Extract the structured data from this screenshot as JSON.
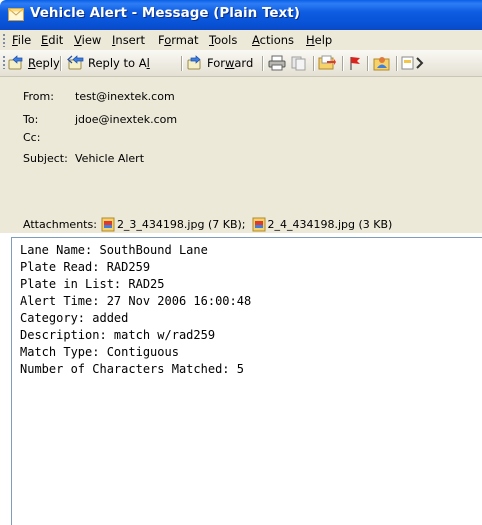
{
  "window": {
    "title": "Vehicle Alert - Message (Plain Text)"
  },
  "menu": [
    {
      "label": "File",
      "mnemonic": "F",
      "rest": "ile"
    },
    {
      "label": "Edit",
      "mnemonic": "E",
      "rest": "dit"
    },
    {
      "label": "View",
      "mnemonic": "V",
      "rest": "iew"
    },
    {
      "label": "Insert",
      "mnemonic": "I",
      "rest": "nsert"
    },
    {
      "label": "Format",
      "pre": "F",
      "mnemonic": "o",
      "rest": "rmat"
    },
    {
      "label": "Tools",
      "mnemonic": "T",
      "rest": "ools"
    },
    {
      "label": "Actions",
      "mnemonic": "A",
      "rest": "ctions"
    },
    {
      "label": "Help",
      "mnemonic": "H",
      "rest": "elp"
    }
  ],
  "toolbar": {
    "reply": {
      "mnemonic": "R",
      "rest": "eply"
    },
    "reply_all": {
      "pre": "Reply to A",
      "mnemonic": "l",
      "rest": "l"
    },
    "forward": {
      "pre": "For",
      "mnemonic": "w",
      "rest": "ard"
    },
    "icons": [
      "reply-icon",
      "reply-all-icon",
      "forward-icon",
      "print-icon",
      "copy-icon",
      "move-to-folder-icon",
      "flag-icon",
      "contacts-icon",
      "view-icon"
    ]
  },
  "header": {
    "from_label": "From:",
    "from_value": "test@inextek.com",
    "to_label": "To:",
    "to_value": "jdoe@inextek.com",
    "cc_label": "Cc:",
    "cc_value": "",
    "subject_label": "Subject:",
    "subject_value": "Vehicle Alert",
    "attachments_label": "Attachments:",
    "attachments": [
      {
        "name": "2_3_434198.jpg",
        "size": "(7 KB);"
      },
      {
        "name": "2_4_434198.jpg",
        "size": "(3 KB)"
      }
    ]
  },
  "body": {
    "lines": [
      "Lane Name: SouthBound Lane",
      "Plate Read: RAD259",
      "Plate in List: RAD25",
      "Alert Time: 27 Nov 2006 16:00:48",
      "Category: added",
      "Description: match w/rad259",
      "Match Type: Contiguous",
      "Number of Characters Matched: 5"
    ]
  },
  "colors": {
    "titlebar": "#0a5fe6",
    "chrome": "#ece9d8",
    "body_border": "#7f9db9"
  }
}
